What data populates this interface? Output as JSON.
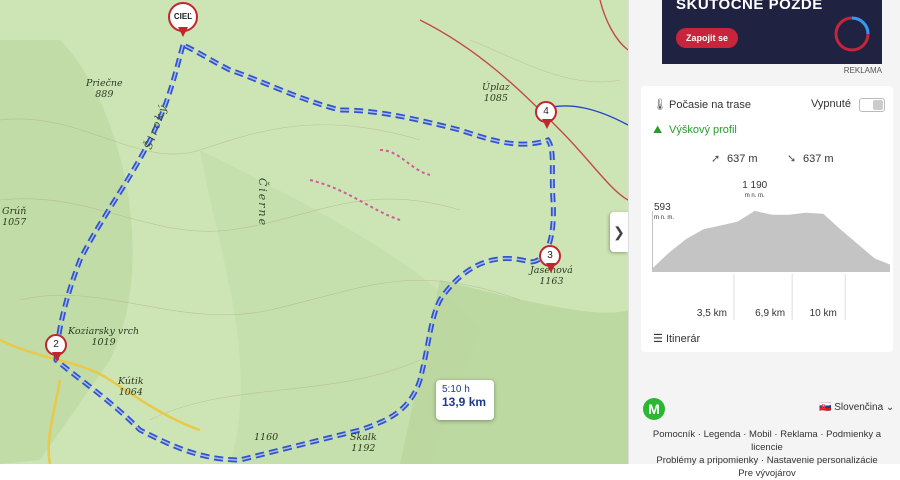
{
  "map": {
    "places": [
      {
        "name": "Priečne",
        "elev": "889"
      },
      {
        "name": "Úplaz",
        "elev": "1085"
      },
      {
        "name": "Grúň",
        "elev": "1057"
      },
      {
        "name": "Koziarsky vrch",
        "elev": "1019"
      },
      {
        "name": "Kútik",
        "elev": "1064"
      },
      {
        "name": "",
        "elev": "1160"
      },
      {
        "name": "Skalk",
        "elev": "1192"
      },
      {
        "name": "Jasenová",
        "elev": "1163"
      }
    ],
    "ridge_labels": [
      "Široký",
      "Čierne"
    ],
    "markers": [
      {
        "label": "CIEĽ"
      },
      {
        "label": "2"
      },
      {
        "label": "3"
      },
      {
        "label": "4"
      }
    ],
    "route_time": "5:10 h",
    "route_distance": "13,9 km"
  },
  "ad": {
    "headline": "SKUTOČNÉ POZDE",
    "button": "Zapojit se",
    "label": "REKLAMA"
  },
  "panel": {
    "weather_label": "Počasie na trase",
    "weather_state": "Vypnuté",
    "profile_label": "Výškový profil",
    "ascent": "637 m",
    "descent": "637 m",
    "itinerary_label": "Itinerár"
  },
  "chart_data": {
    "type": "area",
    "x": [
      0,
      1,
      2,
      3,
      4,
      5,
      6,
      7,
      8,
      9,
      10,
      11,
      12,
      13,
      13.9
    ],
    "values": [
      593,
      760,
      900,
      1000,
      1040,
      1080,
      1190,
      1150,
      1150,
      1170,
      1160,
      1000,
      850,
      700,
      637
    ],
    "annotations": {
      "start": "593",
      "start_unit": "m n. m.",
      "max": "1 190",
      "max_unit": "m n. m."
    },
    "x_ticks": [
      "3,5 km",
      "6,9 km",
      "10 km"
    ],
    "color": "#c4c4c4"
  },
  "footer": {
    "language": "Slovenčina",
    "links": [
      "Pomocník",
      "Legenda",
      "Mobil",
      "Reklama",
      "Podmienky a licencie",
      "Problémy a pripomienky",
      "Nastavenie personalizácie",
      "Pre vývojárov"
    ]
  }
}
